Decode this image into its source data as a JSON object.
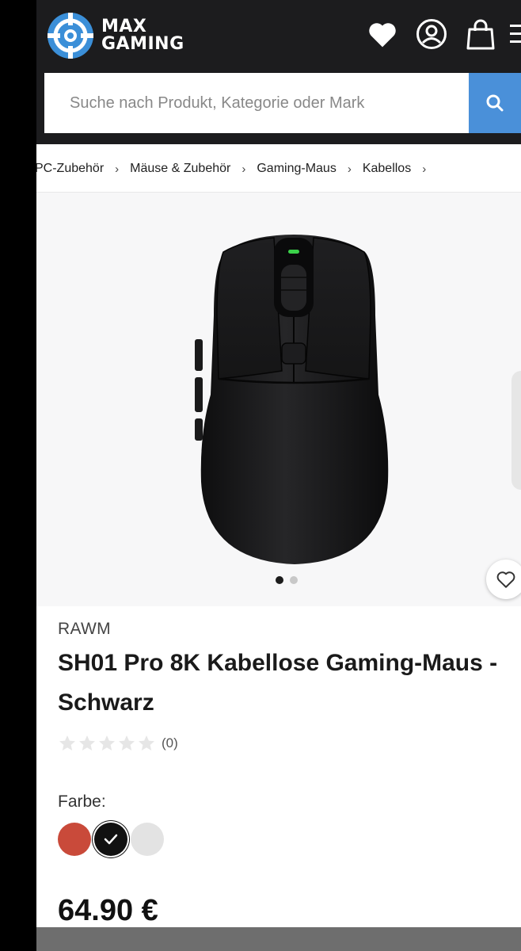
{
  "header": {
    "logo_line1": "MAX",
    "logo_line2": "GAMING",
    "icons": [
      "heart-icon",
      "account-icon",
      "cart-bag-icon",
      "menu-icon"
    ]
  },
  "search": {
    "placeholder": "Suche nach Produkt, Kategorie oder Mark",
    "button_icon": "search-icon"
  },
  "breadcrumb": {
    "items": [
      "PC-Zubehör",
      "Mäuse & Zubehör",
      "Gaming-Maus",
      "Kabellos"
    ],
    "separator": "›"
  },
  "gallery": {
    "image_alt": "mouse-image",
    "total_slides": 2,
    "active_slide": 1
  },
  "product": {
    "brand": "RAWM",
    "title": "SH01 Pro 8K Kabellose Gaming-Maus - Schwarz",
    "rating_stars": 0,
    "rating_max": 5,
    "rating_count": "(0)",
    "color_label": "Farbe:",
    "colors": [
      {
        "name": "red",
        "hex": "#c94a3a",
        "selected": false
      },
      {
        "name": "black",
        "hex": "#111111",
        "selected": true
      },
      {
        "name": "white",
        "hex": "#e3e3e3",
        "selected": false
      }
    ],
    "price": "64.90 €"
  },
  "colors": {
    "header_bg": "#1c1c1e",
    "search_button": "#4a90d9",
    "gallery_bg": "#f7f7f8",
    "logo_blue": "#3b8fd8"
  }
}
